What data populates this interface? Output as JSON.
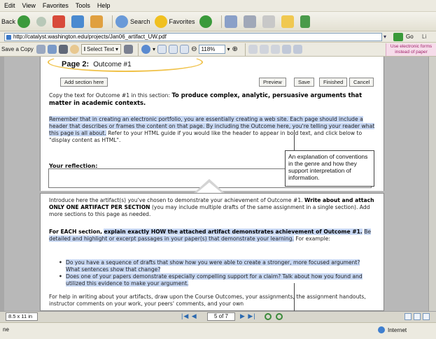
{
  "menu": [
    "Edit",
    "View",
    "Favorites",
    "Tools",
    "Help"
  ],
  "toolbar": {
    "back_label": "Back",
    "search_label": "Search",
    "favorites_label": "Favorites"
  },
  "address": {
    "url": "http://catalyst.washington.edu/projects/Jan06_artifact_UW.pdf",
    "go_label": "Go",
    "links_label": "Li"
  },
  "acrobat": {
    "save_copy_label": "Save a Copy",
    "select_text_label": "Select Text",
    "zoom_value": "118%",
    "note_text": "Use electronic forms instead of paper"
  },
  "page": {
    "heading": "Page 2:",
    "heading_value": "Outcome #1",
    "add_section_label": "Add section here",
    "preview_label": "Preview",
    "save_label": "Save",
    "finished_label": "Finished",
    "cancel_label": "Cancel",
    "copy_text_intro": "Copy the text for Outcome #1 in this section:",
    "copy_text_bold": "To produce complex, analytic, persuasive arguments that matter in academic contexts.",
    "remember_text_hl": "Remember that in creating an electronic portfolio, you are essentially creating a web site. Each page should include a header that describes or frames the content on that page. By including the Outcome here, you're telling your reader what this page is all about.",
    "remember_text_rest": "Refer to your HTML guide if you would like the header to appear in bold text, and click below to \"display content as HTML\".",
    "reflection_label": "Your reflection:"
  },
  "callout": {
    "text": "An explanation of conventions in the genre and how they support interpretation of information."
  },
  "page2": {
    "intro_text": "Introduce here the artifact(s) you've chosen to demonstrate your achievement of Outcome #1.",
    "intro_bold": "Write about and attach ONLY ONE ARTIFACT PER SECTION",
    "intro_rest": "(you may include multiple drafts of the same assignment in a single section). Add more sections to this page as needed.",
    "each_bold": "For EACH section,",
    "each_hl": "explain exactly HOW the attached artifact demonstrates achievement of Outcome #1.",
    "each_rest_hl": "Be detailed and highlight or excerpt passages in your paper(s) that demonstrate your learning.",
    "each_tail": "For example:",
    "bullets": [
      "Do you have a sequence of drafts that show how you were able to create a stronger, more focused argument? What sentences show that change?",
      "Does one of your papers demonstrate especially compelling support for a claim? Talk about how you found and utilized this evidence to make your argument."
    ],
    "help_text": "For help in writing about your artifacts, draw upon the Course Outcomes, your assignments, the assignment handouts, instructor comments on your work, your peers' comments, and your own"
  },
  "nav": {
    "page_size": "8.5 x 11 in",
    "page_of": "5 of 7"
  },
  "status": {
    "left": "ne",
    "zone": "Internet"
  },
  "colors": {
    "highlight": "#c8d8f4",
    "oval": "#f0c24a",
    "accent": "#2c6ab0"
  }
}
